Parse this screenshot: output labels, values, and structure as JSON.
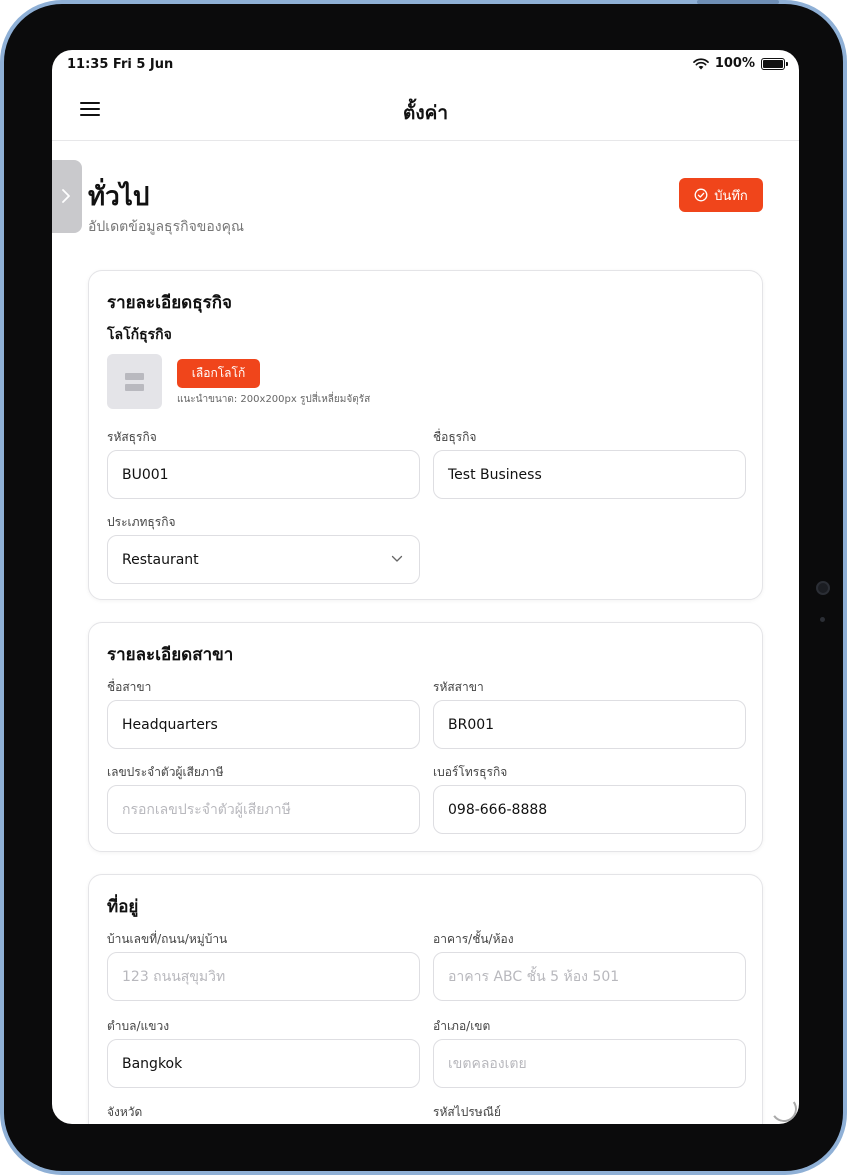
{
  "status": {
    "time_date": "11:35  Fri 5 Jun",
    "battery": "100%",
    "battery_level": 1.0
  },
  "nav": {
    "title": "ตั้งค่า"
  },
  "page": {
    "title": "ทั่วไป",
    "subtitle": "อัปเดตข้อมูลธุรกิจของคุณ",
    "save_label": "บันทึก"
  },
  "business": {
    "title": "รายละเอียดธุรกิจ",
    "logo_label": "โลโก้ธุรกิจ",
    "choose_logo": "เลือกโลโก้",
    "logo_hint": "แนะนำขนาด: 200x200px รูปสี่เหลี่ยมจัตุรัส",
    "code_label": "รหัสธุรกิจ",
    "code_value": "BU001",
    "name_label": "ชื่อธุรกิจ",
    "name_value": "Test Business",
    "type_label": "ประเภทธุรกิจ",
    "type_value": "Restaurant"
  },
  "branch": {
    "title": "รายละเอียดสาขา",
    "name_label": "ชื่อสาขา",
    "name_value": "Headquarters",
    "code_label": "รหัสสาขา",
    "code_value": "BR001",
    "tax_label": "เลขประจำตัวผู้เสียภาษี",
    "tax_placeholder": "กรอกเลขประจำตัวผู้เสียภาษี",
    "phone_label": "เบอร์โทรธุรกิจ",
    "phone_value": "098-666-8888"
  },
  "address": {
    "title": "ที่อยู่",
    "street_label": "บ้านเลขที่/ถนน/หมู่บ้าน",
    "street_placeholder": "123 ถนนสุขุมวิท",
    "building_label": "อาคาร/ชั้น/ห้อง",
    "building_placeholder": "อาคาร ABC ชั้น 5 ห้อง 501",
    "subdistrict_label": "ตำบล/แขวง",
    "subdistrict_value": "Bangkok",
    "district_label": "อำเภอ/เขต",
    "district_placeholder": "เขตคลองเตย",
    "province_label": "จังหวัด",
    "postal_label": "รหัสไปรษณีย์"
  },
  "colors": {
    "accent": "#f0451b",
    "device_frame": "#8fb0d6"
  }
}
